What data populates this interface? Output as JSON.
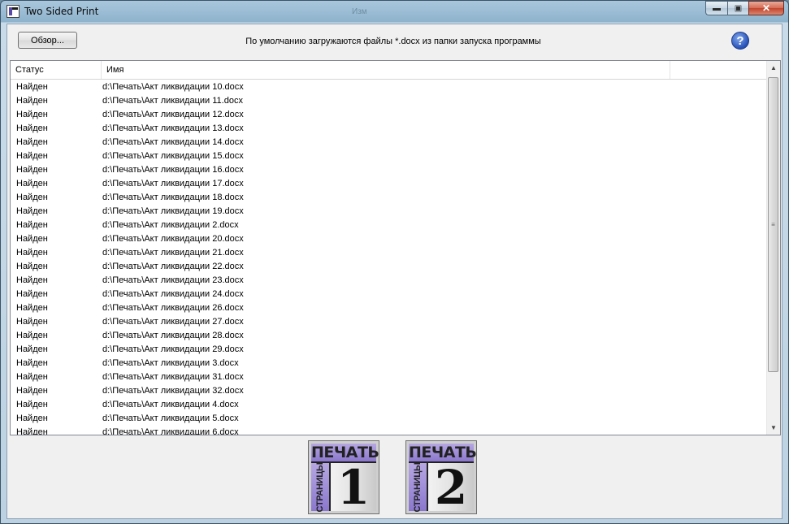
{
  "window": {
    "title": "Two Sided Print",
    "background_title": "Изм"
  },
  "toolbar": {
    "browse_label": "Обзор...",
    "hint": "По умолчанию загружаются файлы *.docx из папки запуска программы",
    "help_glyph": "?"
  },
  "list": {
    "columns": [
      "Статус",
      "Имя"
    ],
    "rows": [
      {
        "status": "Найден",
        "name": "d:\\Печать\\Акт ликвидации 10.docx"
      },
      {
        "status": "Найден",
        "name": "d:\\Печать\\Акт ликвидации 11.docx"
      },
      {
        "status": "Найден",
        "name": "d:\\Печать\\Акт ликвидации 12.docx"
      },
      {
        "status": "Найден",
        "name": "d:\\Печать\\Акт ликвидации 13.docx"
      },
      {
        "status": "Найден",
        "name": "d:\\Печать\\Акт ликвидации 14.docx"
      },
      {
        "status": "Найден",
        "name": "d:\\Печать\\Акт ликвидации 15.docx"
      },
      {
        "status": "Найден",
        "name": "d:\\Печать\\Акт ликвидации 16.docx"
      },
      {
        "status": "Найден",
        "name": "d:\\Печать\\Акт ликвидации 17.docx"
      },
      {
        "status": "Найден",
        "name": "d:\\Печать\\Акт ликвидации 18.docx"
      },
      {
        "status": "Найден",
        "name": "d:\\Печать\\Акт ликвидации 19.docx"
      },
      {
        "status": "Найден",
        "name": "d:\\Печать\\Акт ликвидации 2.docx"
      },
      {
        "status": "Найден",
        "name": "d:\\Печать\\Акт ликвидации 20.docx"
      },
      {
        "status": "Найден",
        "name": "d:\\Печать\\Акт ликвидации 21.docx"
      },
      {
        "status": "Найден",
        "name": "d:\\Печать\\Акт ликвидации 22.docx"
      },
      {
        "status": "Найден",
        "name": "d:\\Печать\\Акт ликвидации 23.docx"
      },
      {
        "status": "Найден",
        "name": "d:\\Печать\\Акт ликвидации 24.docx"
      },
      {
        "status": "Найден",
        "name": "d:\\Печать\\Акт ликвидации 26.docx"
      },
      {
        "status": "Найден",
        "name": "d:\\Печать\\Акт ликвидации 27.docx"
      },
      {
        "status": "Найден",
        "name": "d:\\Печать\\Акт ликвидации 28.docx"
      },
      {
        "status": "Найден",
        "name": "d:\\Печать\\Акт ликвидации 29.docx"
      },
      {
        "status": "Найден",
        "name": "d:\\Печать\\Акт ликвидации 3.docx"
      },
      {
        "status": "Найден",
        "name": "d:\\Печать\\Акт ликвидации 31.docx"
      },
      {
        "status": "Найден",
        "name": "d:\\Печать\\Акт ликвидации 32.docx"
      },
      {
        "status": "Найден",
        "name": "d:\\Печать\\Акт ликвидации 4.docx"
      },
      {
        "status": "Найден",
        "name": "d:\\Печать\\Акт ликвидации 5.docx"
      },
      {
        "status": "Найден",
        "name": "d:\\Печать\\Акт ликвидации 6.docx"
      }
    ]
  },
  "print_buttons": [
    {
      "header": "ПЕЧАТЬ",
      "side": "СТРАНИЦЫ",
      "digit": "1"
    },
    {
      "header": "ПЕЧАТЬ",
      "side": "СТРАНИЦЫ",
      "digit": "2"
    }
  ],
  "icons": {
    "app": "app-icon",
    "minimize": "minimize-icon",
    "maximize": "maximize-icon",
    "close": "close-icon",
    "help": "help-icon"
  },
  "colors": {
    "accent": "#8a77cd",
    "help_blue": "#2851b8",
    "close_red": "#c3432c"
  }
}
